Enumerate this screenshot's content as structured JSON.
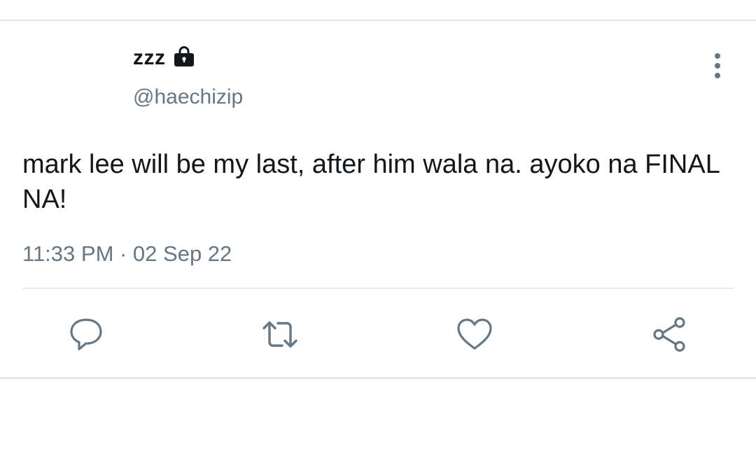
{
  "tweet": {
    "display_name": "zzz",
    "handle": "@haechizip",
    "text": "mark lee will be my last, after him wala na. ayoko na FINAL NA!",
    "timestamp": "11:33 PM · 02 Sep 22",
    "protected_icon": "lock-icon"
  },
  "actions": {
    "reply_icon": "reply-icon",
    "retweet_icon": "retweet-icon",
    "like_icon": "heart-icon",
    "share_icon": "share-icon"
  },
  "colors": {
    "primary_text": "#14171a",
    "secondary_text": "#657786",
    "icon": "#657786",
    "divider": "#e6ecf0"
  }
}
